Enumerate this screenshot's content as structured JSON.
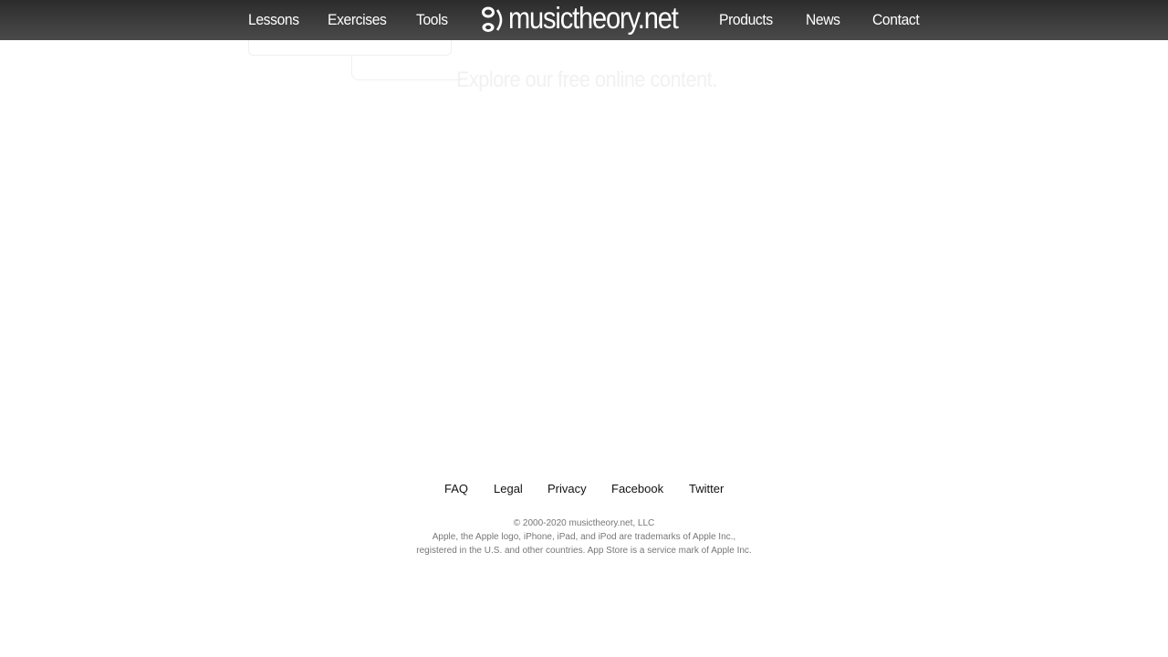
{
  "nav": {
    "left_items": [
      {
        "label": "Lessons"
      },
      {
        "label": "Exercises"
      },
      {
        "label": "Tools"
      }
    ],
    "logo_text": "musictheory.net",
    "logo_icon": "treble-clef-logo-icon",
    "right_items": [
      {
        "label": "Products"
      },
      {
        "label": "News"
      },
      {
        "label": "Contact"
      }
    ]
  },
  "main": {
    "tagline": "Explore our free online content."
  },
  "footer": {
    "links": [
      {
        "label": "FAQ"
      },
      {
        "label": "Legal"
      },
      {
        "label": "Privacy"
      },
      {
        "label": "Facebook"
      },
      {
        "label": "Twitter"
      }
    ],
    "copyright": "© 2000-2020 musictheory.net, LLC",
    "trademark_line_1": "Apple, the Apple logo, iPhone, iPad, and iPod are trademarks of Apple Inc.,",
    "trademark_line_2": "registered in the U.S. and other countries. App Store is a service mark of Apple Inc."
  },
  "colors": {
    "nav_background_top": "#2c2c2c",
    "nav_background_bottom": "#4a4a4a",
    "nav_text": "#ffffff",
    "footer_link_text": "#111111",
    "legal_text": "#777777"
  }
}
